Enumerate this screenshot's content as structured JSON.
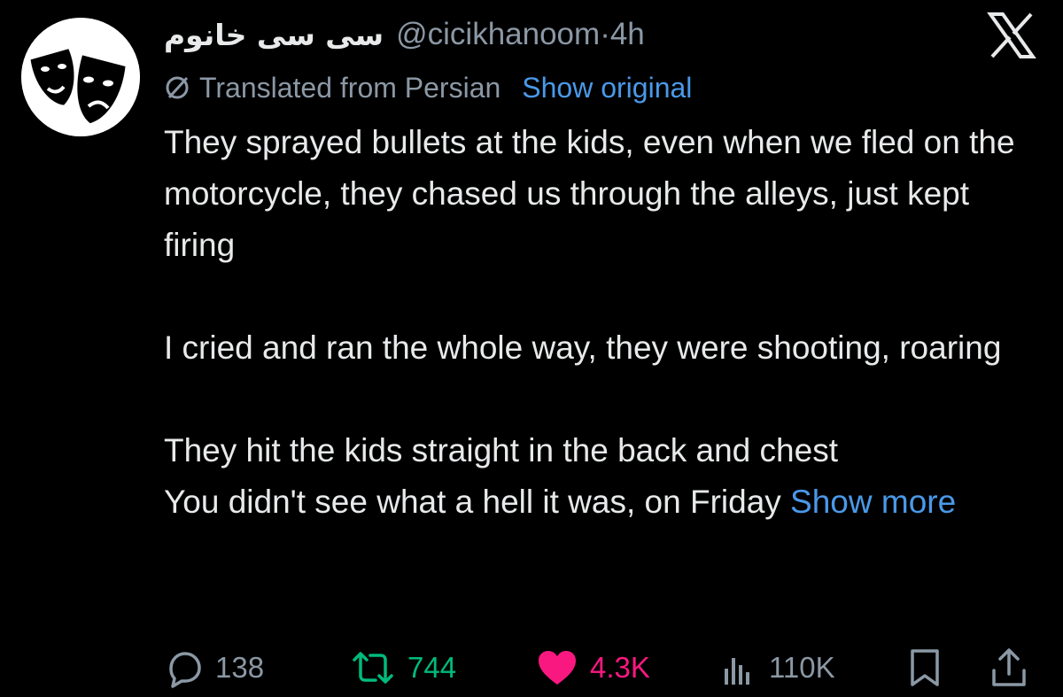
{
  "author": {
    "display_name": "سی سی خانوم",
    "handle": "@cicikhanoom",
    "separator": "·",
    "time": "4h"
  },
  "translation": {
    "notice": "Translated from Persian",
    "show_original": "Show original"
  },
  "tweet": {
    "paragraphs": [
      "They sprayed bullets at the kids, even when we fled on the motorcycle, they chased us through the alleys, just kept firing",
      "I cried and ran the whole way, they were shooting, roaring",
      "They hit the kids straight in the back and chest\nYou didn't see what a hell it was, on Friday "
    ],
    "show_more": "Show more"
  },
  "actions": {
    "replies": "138",
    "reposts": "744",
    "likes": "4.3K",
    "views": "110K"
  },
  "colors": {
    "background": "#000000",
    "text": "#e7e9ea",
    "muted": "#8b98a5",
    "link": "#4a99e9",
    "repost": "#00ba7c",
    "like": "#f91880"
  },
  "icons": [
    "theatre-masks-avatar",
    "x-logo-icon",
    "translate-icon",
    "reply-icon",
    "repost-icon",
    "heart-icon",
    "views-icon",
    "bookmark-icon",
    "share-icon"
  ]
}
